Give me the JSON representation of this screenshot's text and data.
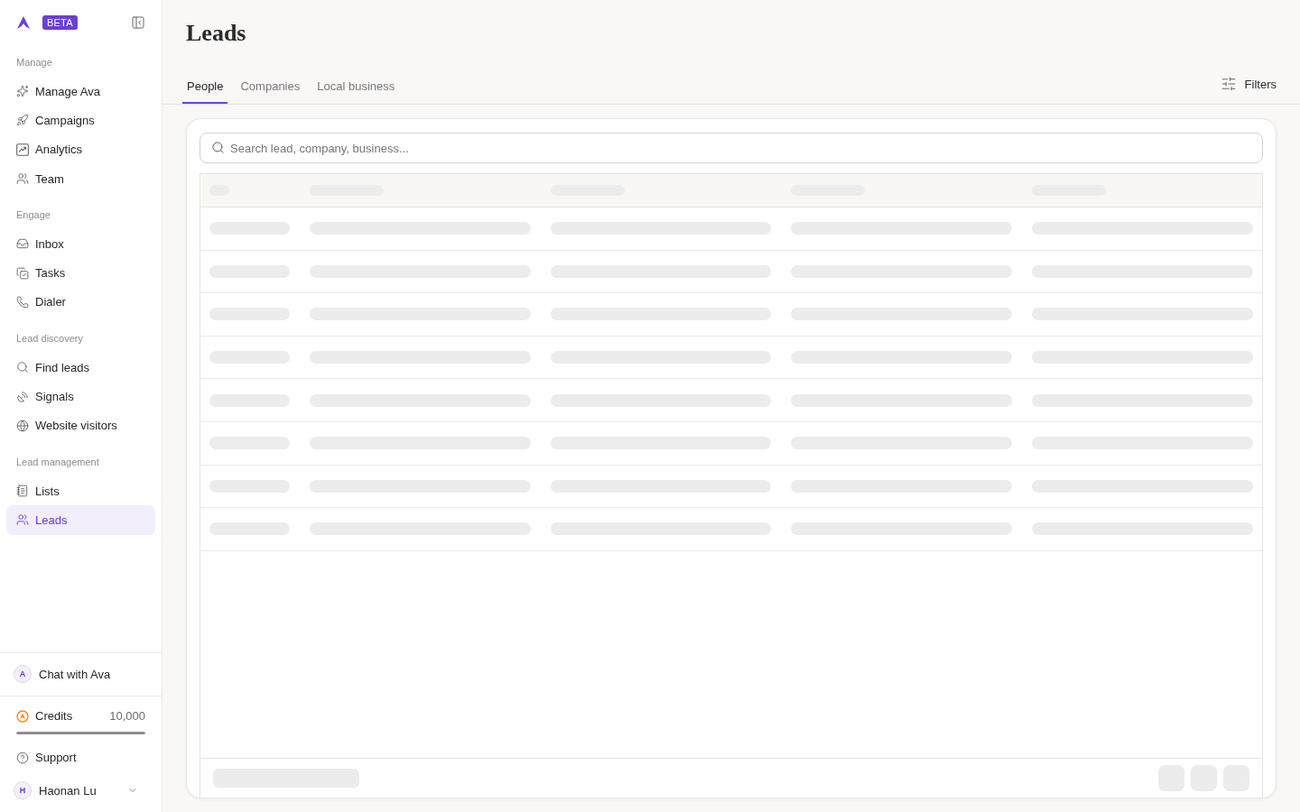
{
  "sidebar": {
    "badge": "BETA",
    "sections": [
      {
        "title": "Manage",
        "items": [
          {
            "label": "Manage Ava",
            "selected": false
          },
          {
            "label": "Campaigns",
            "selected": false
          },
          {
            "label": "Analytics",
            "selected": false
          },
          {
            "label": "Team",
            "selected": false
          }
        ]
      },
      {
        "title": "Engage",
        "items": [
          {
            "label": "Inbox",
            "selected": false
          },
          {
            "label": "Tasks",
            "selected": false
          },
          {
            "label": "Dialer",
            "selected": false
          }
        ]
      },
      {
        "title": "Lead discovery",
        "items": [
          {
            "label": "Find leads",
            "selected": false
          },
          {
            "label": "Signals",
            "selected": false
          },
          {
            "label": "Website visitors",
            "selected": false
          }
        ]
      },
      {
        "title": "Lead management",
        "items": [
          {
            "label": "Lists",
            "selected": false
          },
          {
            "label": "Leads",
            "selected": true
          }
        ]
      }
    ],
    "chat": {
      "avatar": "A",
      "label": "Chat with Ava"
    },
    "credits": {
      "label": "Credits",
      "value": "10,000",
      "level": 1
    },
    "support": {
      "label": "Support"
    },
    "user": {
      "avatar": "H",
      "name": "Haonan Lu"
    }
  },
  "page": {
    "title": "Leads",
    "tabs": [
      {
        "label": "People",
        "selected": true
      },
      {
        "label": "Companies",
        "selected": false
      },
      {
        "label": "Local business",
        "selected": false
      }
    ],
    "filters": {
      "label": "Filters"
    }
  },
  "search": {
    "placeholder": "Search lead, company, business..."
  },
  "table": {
    "loading": true
  }
}
